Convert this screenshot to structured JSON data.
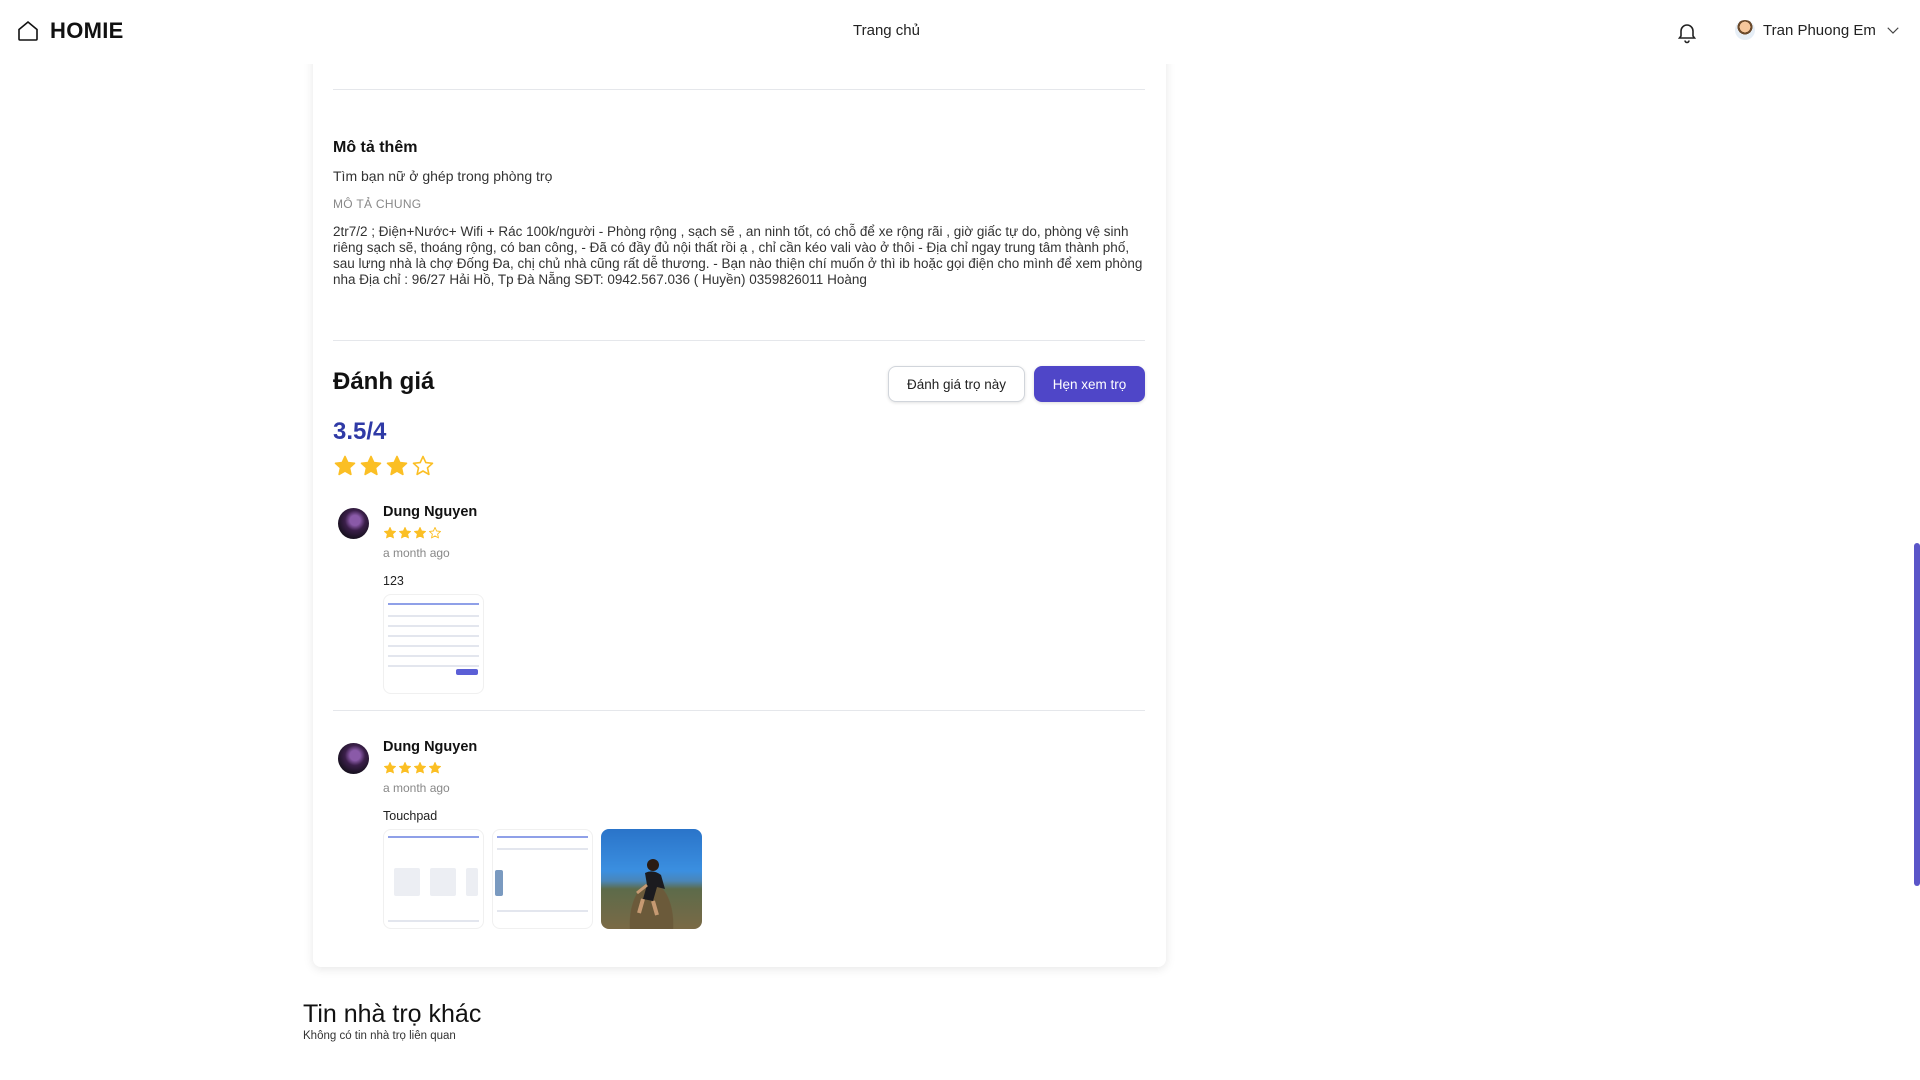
{
  "header": {
    "logo_text": "HOMIE",
    "nav_home": "Trang chủ",
    "user_name": "Tran Phuong Em"
  },
  "description": {
    "title": "Mô tả thêm",
    "short": "Tìm bạn nữ ở ghép trong phòng trọ",
    "label": "MÔ TẢ CHUNG",
    "body": "2tr7/2 ; Điện+Nước+ Wifi + Rác 100k/người - Phòng rộng , sạch sẽ , an ninh tốt, có chỗ để xe rộng rãi , giờ giấc tự do, phòng vệ sinh riêng sạch sẽ, thoáng rộng, có ban công, - Đã có đầy đủ nội thất rồi ạ , chỉ cần kéo vali vào ở thôi - Địa chỉ ngay trung tâm thành phố, sau lưng nhà là chợ Đống Đa, chị chủ nhà cũng rất dễ thương. - Bạn nào thiện chí muốn ở thì ib hoặc gọi điện cho mình để xem phòng nha Địa chỉ : 96/27 Hải Hồ, Tp Đà Nẵng SĐT: 0942.567.036 ( Huyền) 0359826011 Hoàng"
  },
  "reviews_section": {
    "title": "Đánh giá",
    "rate_button": "Đánh giá trọ này",
    "book_button": "Hẹn xem trọ",
    "score": "3.5/4",
    "score_stars_filled": 3,
    "score_stars_total": 4,
    "reviews": [
      {
        "name": "Dung Nguyen",
        "stars_filled": 3,
        "stars_total": 4,
        "time": "a month ago",
        "text": "123",
        "images": [
          "screenshot"
        ]
      },
      {
        "name": "Dung Nguyen",
        "stars_filled": 4,
        "stars_total": 4,
        "time": "a month ago",
        "text": "Touchpad",
        "images": [
          "screenshot",
          "screenshot",
          "photo"
        ]
      }
    ]
  },
  "other": {
    "title": "Tin nhà trọ khác",
    "empty": "Không có tin nhà trọ liên quan"
  },
  "colors": {
    "accent": "#4f46c8",
    "score": "#2f3aa6",
    "star": "#fbbf24"
  }
}
